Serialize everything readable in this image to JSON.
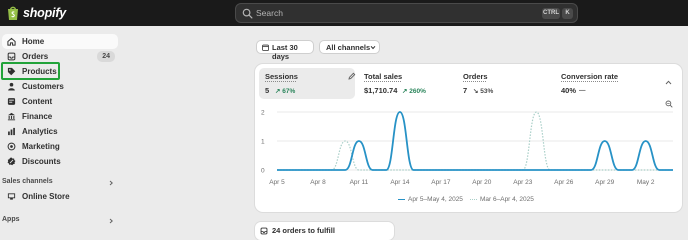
{
  "brand": {
    "name": "shopify",
    "logo_icon": "shopify-bag-icon"
  },
  "search": {
    "placeholder": "Search",
    "shortcut_keys": [
      "CTRL",
      "K"
    ]
  },
  "sidebar": {
    "items": [
      {
        "label": "Home",
        "icon": "home-icon",
        "active": true
      },
      {
        "label": "Orders",
        "icon": "orders-icon",
        "badge": "24"
      },
      {
        "label": "Products",
        "icon": "tag-icon"
      },
      {
        "label": "Customers",
        "icon": "person-icon"
      },
      {
        "label": "Content",
        "icon": "content-icon"
      },
      {
        "label": "Finance",
        "icon": "bank-icon"
      },
      {
        "label": "Analytics",
        "icon": "bar-chart-icon"
      },
      {
        "label": "Marketing",
        "icon": "target-icon"
      },
      {
        "label": "Discounts",
        "icon": "discount-icon"
      }
    ],
    "sales_channels": {
      "title": "Sales channels",
      "items": [
        {
          "label": "Online Store",
          "icon": "store-icon"
        }
      ]
    },
    "apps": {
      "title": "Apps"
    }
  },
  "filters": {
    "date_range": "Last 30 days",
    "channels": "All channels"
  },
  "metrics": [
    {
      "title": "Sessions",
      "value": "5",
      "delta": "67%",
      "trend": "up",
      "selected": true
    },
    {
      "title": "Total sales",
      "value": "$1,710.74",
      "delta": "260%",
      "trend": "up"
    },
    {
      "title": "Orders",
      "value": "7",
      "delta": "53%",
      "trend": "down"
    },
    {
      "title": "Conversion rate",
      "value": "40%",
      "delta": "—",
      "trend": "flat"
    }
  ],
  "chart_data": {
    "type": "line",
    "x_ticks": [
      "Apr 5",
      "Apr 8",
      "Apr 11",
      "Apr 14",
      "Apr 17",
      "Apr 20",
      "Apr 23",
      "Apr 26",
      "Apr 29",
      "May 2"
    ],
    "y_ticks": [
      "2",
      "1",
      "0"
    ],
    "ylim": [
      0,
      2
    ],
    "grid": true,
    "legend_position": "bottom",
    "series": [
      {
        "name": "Apr 5–May 4, 2025",
        "color": "#2792c6",
        "style": "solid",
        "x": [
          "Apr 5",
          "Apr 6",
          "Apr 7",
          "Apr 8",
          "Apr 9",
          "Apr 10",
          "Apr 11",
          "Apr 12",
          "Apr 13",
          "Apr 14",
          "Apr 15",
          "Apr 16",
          "Apr 17",
          "Apr 18",
          "Apr 19",
          "Apr 20",
          "Apr 21",
          "Apr 22",
          "Apr 23",
          "Apr 24",
          "Apr 25",
          "Apr 26",
          "Apr 27",
          "Apr 28",
          "Apr 29",
          "Apr 30",
          "May 1",
          "May 2",
          "May 3",
          "May 4"
        ],
        "values": [
          0,
          0,
          0,
          0,
          0,
          0,
          1,
          0,
          0,
          2,
          0,
          0,
          0,
          0,
          0,
          0,
          0,
          0,
          0,
          0,
          0,
          0,
          0,
          0,
          1,
          0,
          0,
          1,
          0,
          0
        ]
      },
      {
        "name": "Mar 6–Apr 4, 2025",
        "color": "#a9cfc8",
        "style": "dotted",
        "x": [
          "Apr 5",
          "Apr 6",
          "Apr 7",
          "Apr 8",
          "Apr 9",
          "Apr 10",
          "Apr 11",
          "Apr 12",
          "Apr 13",
          "Apr 14",
          "Apr 15",
          "Apr 16",
          "Apr 17",
          "Apr 18",
          "Apr 19",
          "Apr 20",
          "Apr 21",
          "Apr 22",
          "Apr 23",
          "Apr 24",
          "Apr 25",
          "Apr 26",
          "Apr 27",
          "Apr 28",
          "Apr 29",
          "Apr 30",
          "May 1",
          "May 2",
          "May 3",
          "May 4"
        ],
        "values": [
          0,
          0,
          0,
          0,
          0,
          1,
          0,
          0,
          0,
          0,
          0,
          0,
          0,
          0,
          0,
          0,
          0,
          0,
          0,
          2,
          0,
          0,
          0,
          0,
          0,
          0,
          0,
          0,
          0,
          0
        ]
      }
    ]
  },
  "orders_card": {
    "label": "24 orders to fulfill"
  }
}
